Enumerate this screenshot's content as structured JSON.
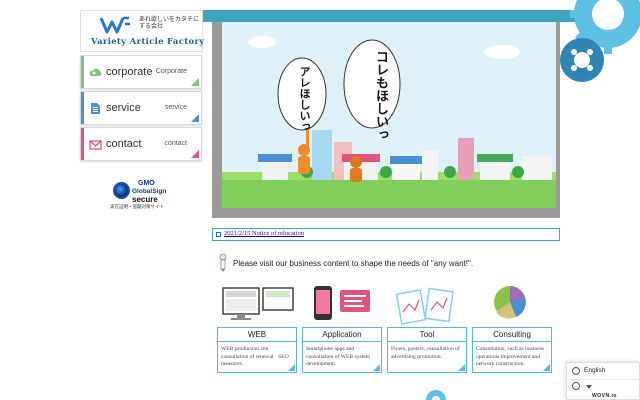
{
  "logo": {
    "tagline": "あれ欲しいをカタチにする会社",
    "name": "Variety Article Factory"
  },
  "nav": [
    {
      "label": "corporate",
      "sub": "Corporate",
      "color": "#7cc576"
    },
    {
      "label": "service",
      "sub": "service",
      "color": "#4a8ed3"
    },
    {
      "label": "contact",
      "sub": "contact",
      "color": "#e0557a"
    }
  ],
  "gmo": {
    "line1": "GMO",
    "line2": "GlobalSign",
    "line3": "secure",
    "line4": "実在証明・盗聴対策サイト"
  },
  "hero": {
    "bubble_left": "アレほしいっ",
    "bubble_right": "コレもほしいっ"
  },
  "news": {
    "link": "2021/2/15 Notice of relocation"
  },
  "intro": "Please visit our business content to shape the needs of \"any want!\".",
  "services": [
    {
      "title": "WEB",
      "desc": "WEB production site consultation of renewal · SEO measures."
    },
    {
      "title": "Application",
      "desc": "Smartphone apps and consultation of WEB system development."
    },
    {
      "title": "Tool",
      "desc": "Flyers, posters, consultation of advertising promotion."
    },
    {
      "title": "Consulting",
      "desc": "Consultation, such as business operations improvement and network construction."
    }
  ],
  "language": {
    "selected": "English",
    "brand": "WOVN.io"
  },
  "colors": {
    "accent": "#3da3c1",
    "card_border": "#59b6de"
  }
}
